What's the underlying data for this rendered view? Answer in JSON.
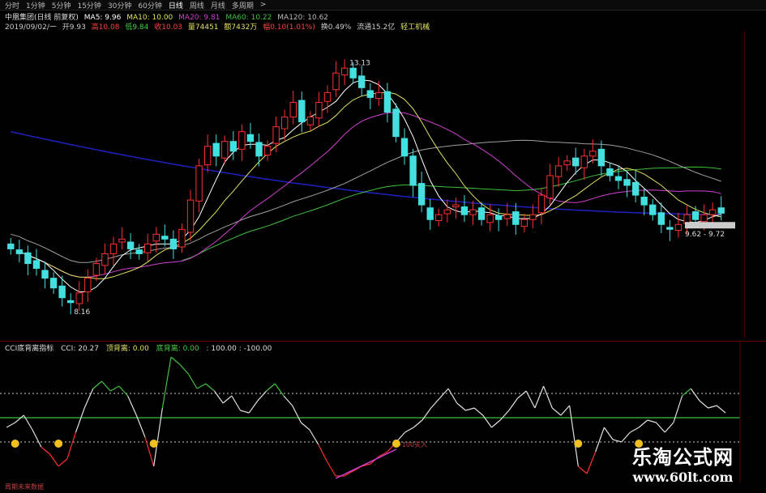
{
  "toolbar": {
    "items": [
      "分时",
      "1分钟",
      "5分钟",
      "15分钟",
      "30分钟",
      "60分钟",
      "日线",
      "周线",
      "月线",
      "多周期",
      ">"
    ],
    "active_index": 6
  },
  "header": {
    "title": "中凰集团(日线 前复权)",
    "ma5": "MA5: 9.96",
    "ma10": "MA10: 10.00",
    "ma20": "MA20: 9.81",
    "ma60": "MA60: 10.22",
    "ma120": "MA120: 10.62"
  },
  "quote": {
    "date": "2019/09/02/一",
    "open": "开9.93",
    "high": "高10.08",
    "low": "低9.84",
    "close": "收10.03",
    "volume": "量74451",
    "amount": "额7432万",
    "change": "幅0.10(1.01%)",
    "turnover": "换0.49%",
    "float": "流通15.2亿",
    "industry": "轻工机械"
  },
  "annotations": {
    "high_label": "13.13",
    "low_label": "8.16",
    "range_label": "9.62 - 9.72",
    "buy_label": "-100买入"
  },
  "oscillator": {
    "title": "CCI底背离指标",
    "cci": "CCI: 20.27",
    "top_div": "顶背离: 0.00",
    "bottom_div": "底背离: 0.00",
    "levels": ": 100.00 : -100.00"
  },
  "footer": {
    "text": "周期未来数据"
  },
  "watermark": {
    "line1": "乐淘公式网",
    "line2": "www.60lt.com"
  },
  "colors": {
    "up": "#ff3030",
    "down": "#44e0e0",
    "ma5": "#ffffff",
    "ma10": "#e0e060",
    "ma20": "#d040d0",
    "ma60": "#40c040",
    "ma120": "#a0a0a0",
    "long_ma": "#2020c0",
    "cci_line": "#e0e0e0",
    "div_line": "#d040d0",
    "level": "#40c040"
  },
  "chart_data": [
    {
      "type": "candlestick",
      "annotations": [
        "13.13",
        "8.16",
        "9.62 - 9.72"
      ],
      "closes": [
        9.3,
        9.2,
        9.0,
        8.9,
        8.7,
        8.5,
        8.3,
        8.2,
        8.4,
        8.7,
        9.0,
        9.2,
        9.4,
        9.5,
        9.3,
        9.2,
        9.4,
        9.6,
        9.5,
        9.3,
        9.7,
        10.3,
        11.0,
        11.4,
        11.2,
        11.5,
        11.3,
        11.7,
        11.5,
        11.2,
        11.4,
        11.8,
        12.0,
        12.3,
        11.9,
        12.0,
        12.3,
        12.5,
        12.9,
        13.0,
        12.8,
        12.6,
        12.4,
        12.5,
        12.1,
        11.6,
        11.2,
        10.6,
        10.2,
        9.9,
        10.0,
        10.1,
        10.2,
        10.0,
        10.1,
        9.9,
        10.0,
        9.9,
        10.0,
        9.8,
        9.9,
        10.0,
        10.4,
        10.8,
        11.0,
        11.1,
        11.0,
        11.2,
        11.3,
        11.0,
        10.8,
        10.7,
        10.6,
        10.4,
        10.2,
        10.0,
        9.8,
        9.7,
        9.8,
        10.0,
        9.9,
        10.0,
        10.1,
        10.03
      ]
    },
    {
      "type": "line",
      "name": "CCI",
      "levels": [
        100,
        0,
        -100
      ],
      "values": [
        -40,
        -20,
        10,
        -50,
        -120,
        -150,
        -200,
        -170,
        -60,
        40,
        120,
        150,
        110,
        130,
        90,
        10,
        -80,
        -200,
        40,
        250,
        220,
        180,
        120,
        140,
        110,
        60,
        90,
        30,
        20,
        70,
        110,
        140,
        90,
        50,
        -20,
        -50,
        -110,
        -180,
        -240,
        -240,
        -220,
        -200,
        -190,
        -160,
        -140,
        -100,
        -60,
        -40,
        -10,
        40,
        80,
        120,
        60,
        30,
        40,
        10,
        -40,
        -10,
        30,
        80,
        110,
        40,
        130,
        40,
        10,
        50,
        -200,
        -230,
        -140,
        -40,
        -90,
        -100,
        -60,
        -40,
        -10,
        -20,
        -60,
        -20,
        90,
        120,
        70,
        40,
        50,
        20
      ]
    }
  ]
}
